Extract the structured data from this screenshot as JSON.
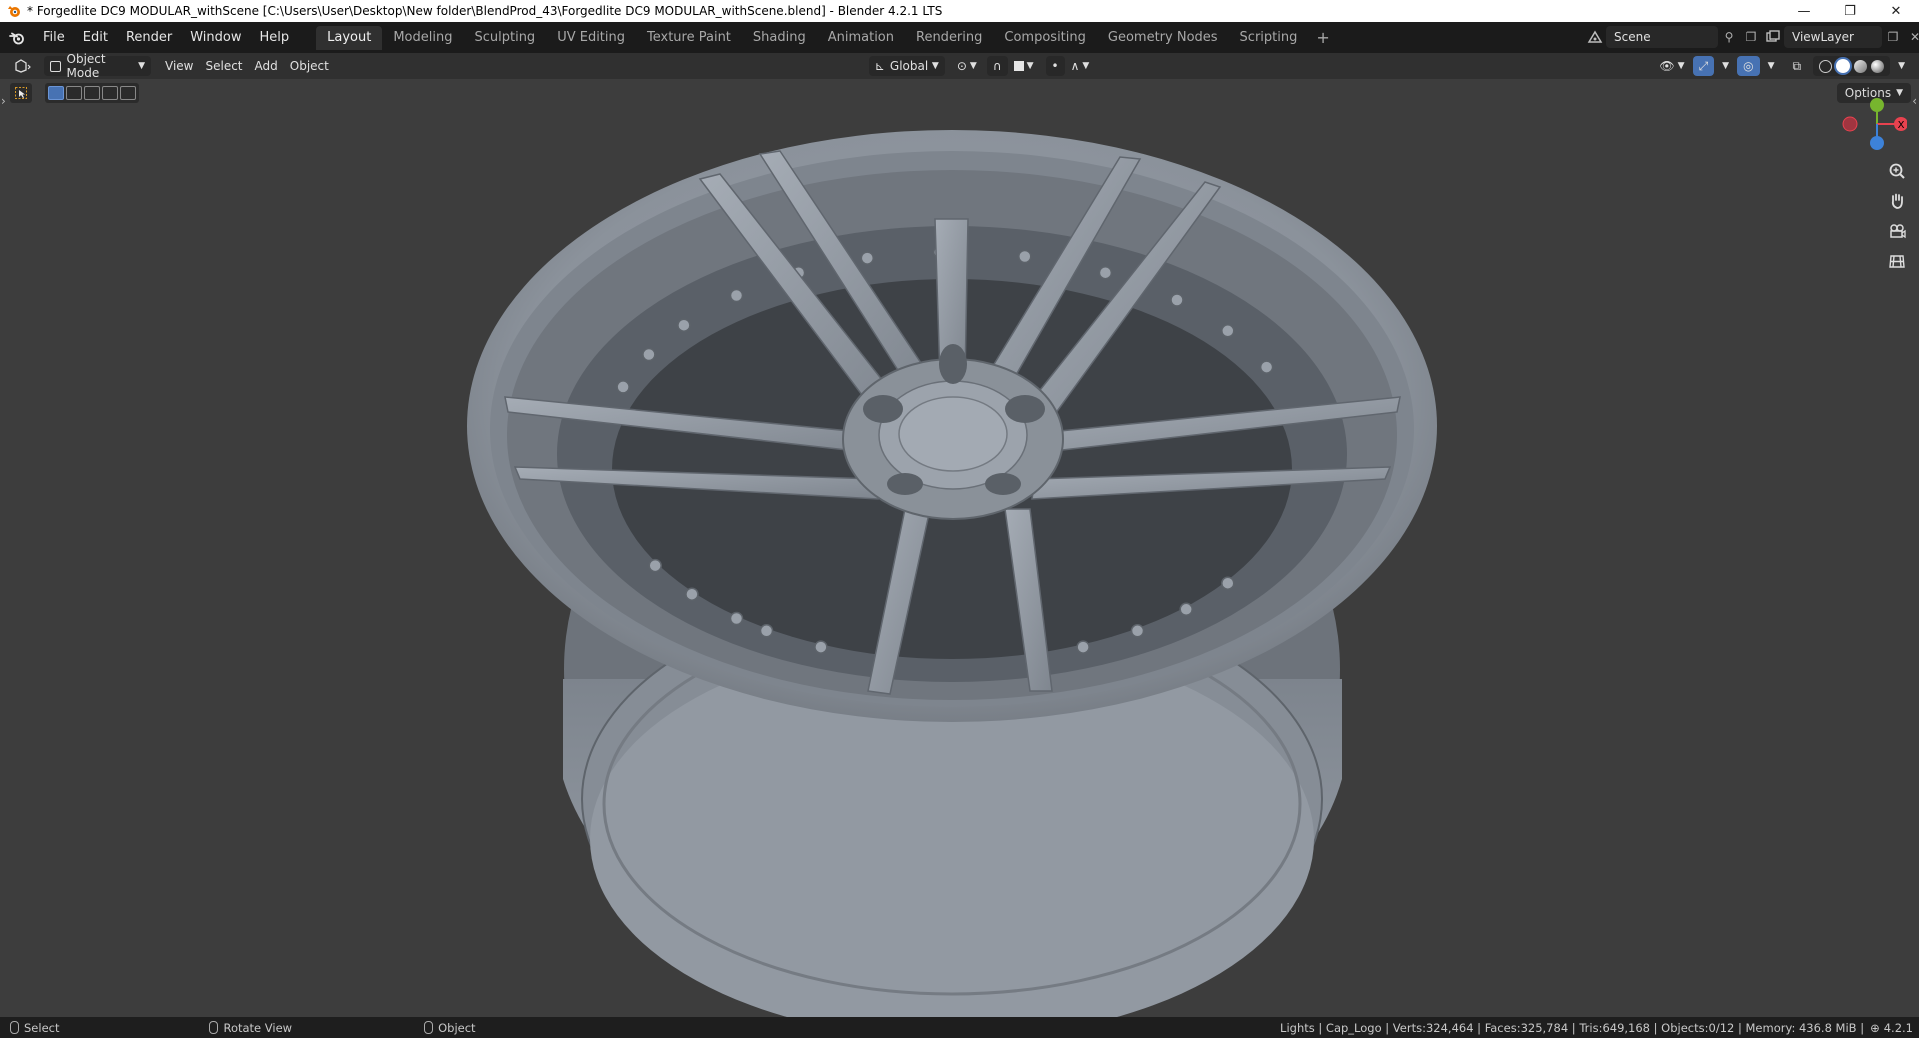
{
  "window": {
    "title": "* Forgedlite DC9 MODULAR_withScene [C:\\Users\\User\\Desktop\\New folder\\BlendProd_43\\Forgedlite DC9 MODULAR_withScene.blend] - Blender 4.2.1 LTS",
    "minimize": "—",
    "maximize": "❐",
    "close": "✕"
  },
  "menu": {
    "items": [
      "File",
      "Edit",
      "Render",
      "Window",
      "Help"
    ]
  },
  "workspaces": {
    "tabs": [
      "Layout",
      "Modeling",
      "Sculpting",
      "UV Editing",
      "Texture Paint",
      "Shading",
      "Animation",
      "Rendering",
      "Compositing",
      "Geometry Nodes",
      "Scripting"
    ],
    "active": "Layout",
    "add": "+"
  },
  "scene": {
    "name": "Scene"
  },
  "view_layer": {
    "name": "ViewLayer"
  },
  "viewport_header": {
    "mode": "Object Mode",
    "menus": [
      "View",
      "Select",
      "Add",
      "Object"
    ],
    "orientation": "Global"
  },
  "viewport": {
    "options_label": "Options",
    "gizmo": {
      "x_label": "X",
      "colors": {
        "x": "#e8424f",
        "y": "#77b52e",
        "z": "#3d82d9"
      }
    },
    "nav_icons": [
      "zoom-icon",
      "pan-hand-icon",
      "camera-icon",
      "grid-icon"
    ]
  },
  "statusbar": {
    "select": "Select",
    "rotate": "Rotate View",
    "object": "Object",
    "stats": "Lights | Cap_Logo | Verts:324,464 | Faces:325,784 | Tris:649,168 | Objects:0/12 | Memory: 436.8 MiB |",
    "version": "4.2.1"
  },
  "colors": {
    "accent": "#4772b3",
    "topbar": "#1b1b1b",
    "header": "#303030",
    "viewport": "#3d3d3d"
  }
}
